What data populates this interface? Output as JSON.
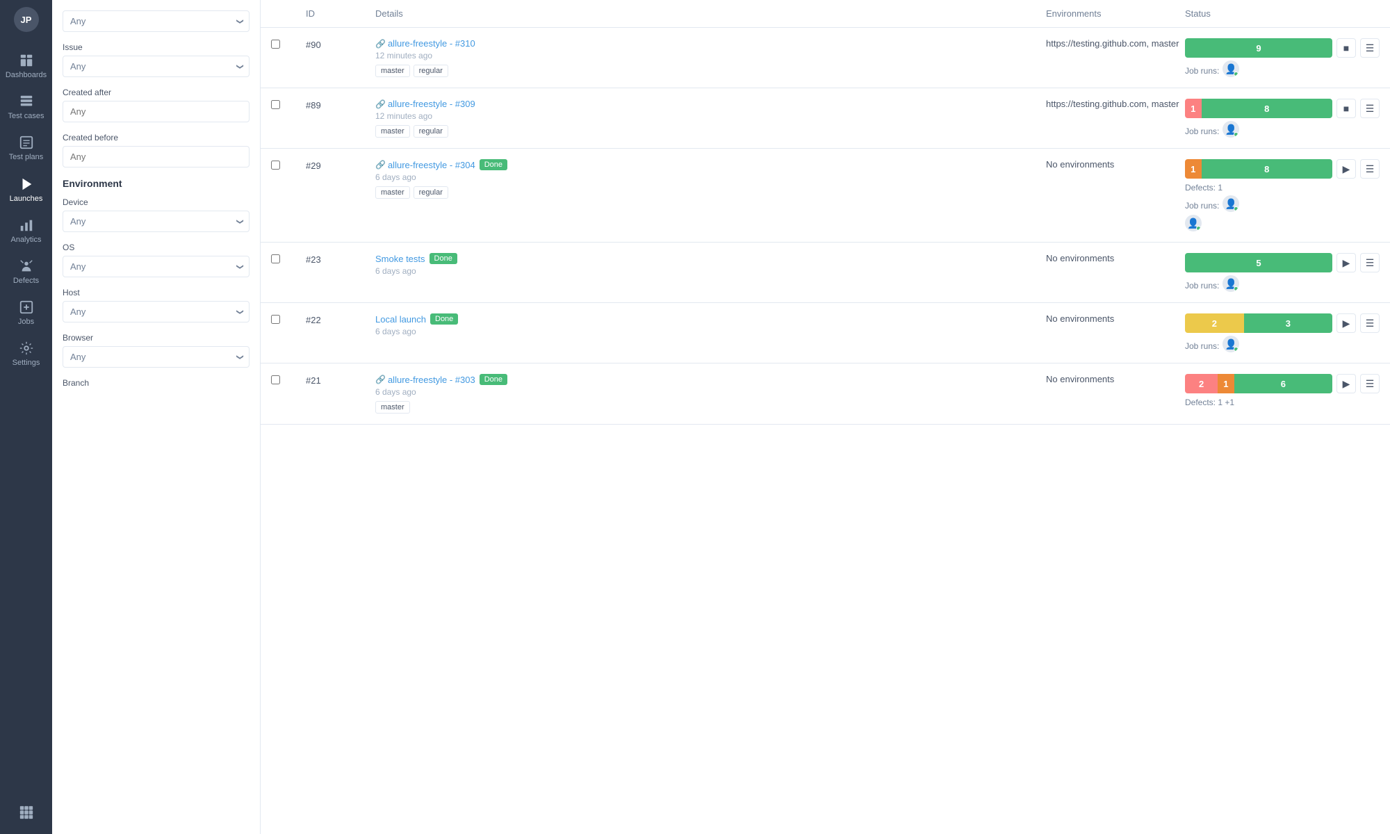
{
  "sidebar": {
    "avatar": "JP",
    "items": [
      {
        "id": "dashboards",
        "label": "Dashboards",
        "icon": "dashboard"
      },
      {
        "id": "test-cases",
        "label": "Test cases",
        "icon": "testcases",
        "active": false
      },
      {
        "id": "test-plans",
        "label": "Test plans",
        "icon": "testplans"
      },
      {
        "id": "launches",
        "label": "Launches",
        "icon": "launches",
        "active": true
      },
      {
        "id": "analytics",
        "label": "Analytics",
        "icon": "analytics"
      },
      {
        "id": "defects",
        "label": "Defects",
        "icon": "defects"
      },
      {
        "id": "jobs",
        "label": "Jobs",
        "icon": "jobs"
      },
      {
        "id": "settings",
        "label": "Settings",
        "icon": "settings"
      },
      {
        "id": "integrations",
        "label": "",
        "icon": "integrations"
      }
    ]
  },
  "filters": {
    "issue_label": "Issue",
    "created_after_label": "Created after",
    "created_before_label": "Created before",
    "environment_title": "Environment",
    "device_label": "Device",
    "os_label": "OS",
    "host_label": "Host",
    "browser_label": "Browser",
    "branch_label": "Branch",
    "any_placeholder": "Any"
  },
  "table": {
    "columns": [
      "ID",
      "Details",
      "Environments",
      "Status"
    ],
    "rows": [
      {
        "id": "#90",
        "link_text": "allure-freestyle - #310",
        "time": "12 minutes ago",
        "tags": [
          "master",
          "regular"
        ],
        "done_badge": false,
        "env": "https://testing.github.com, master",
        "status_segments": [
          {
            "color": "green",
            "value": "9",
            "flex": 9
          }
        ],
        "defects": "",
        "has_stop_btn": true,
        "has_play_btn": false,
        "avatars": 1
      },
      {
        "id": "#89",
        "link_text": "allure-freestyle - #309",
        "time": "12 minutes ago",
        "tags": [
          "master",
          "regular"
        ],
        "done_badge": false,
        "env": "https://testing.github.com, master",
        "status_segments": [
          {
            "color": "red",
            "value": "1",
            "flex": 1
          },
          {
            "color": "green",
            "value": "8",
            "flex": 8
          }
        ],
        "defects": "",
        "has_stop_btn": true,
        "has_play_btn": false,
        "avatars": 1
      },
      {
        "id": "#29",
        "link_text": "allure-freestyle - #304",
        "time": "6 days ago",
        "tags": [
          "master",
          "regular"
        ],
        "done_badge": true,
        "env": "No environments",
        "status_segments": [
          {
            "color": "orange",
            "value": "1",
            "flex": 1
          },
          {
            "color": "green",
            "value": "8",
            "flex": 8
          }
        ],
        "defects": "Defects: 1",
        "has_stop_btn": false,
        "has_play_btn": true,
        "avatars": 2
      },
      {
        "id": "#23",
        "link_text": "Smoke tests",
        "time": "6 days ago",
        "tags": [],
        "done_badge": true,
        "env": "No environments",
        "status_segments": [
          {
            "color": "green",
            "value": "5",
            "flex": 5
          }
        ],
        "defects": "",
        "has_stop_btn": false,
        "has_play_btn": true,
        "avatars": 1
      },
      {
        "id": "#22",
        "link_text": "Local launch",
        "time": "6 days ago",
        "tags": [],
        "done_badge": true,
        "env": "No environments",
        "status_segments": [
          {
            "color": "yellow",
            "value": "2",
            "flex": 2
          },
          {
            "color": "green",
            "value": "3",
            "flex": 3
          }
        ],
        "defects": "",
        "has_stop_btn": false,
        "has_play_btn": true,
        "avatars": 1
      },
      {
        "id": "#21",
        "link_text": "allure-freestyle - #303",
        "time": "6 days ago",
        "tags": [
          "master"
        ],
        "done_badge": true,
        "env": "No environments",
        "status_segments": [
          {
            "color": "red",
            "value": "2",
            "flex": 2
          },
          {
            "color": "orange",
            "value": "1",
            "flex": 1
          },
          {
            "color": "green",
            "value": "6",
            "flex": 6
          }
        ],
        "defects": "Defects: 1 +1",
        "has_stop_btn": false,
        "has_play_btn": true,
        "avatars": 0
      }
    ]
  }
}
